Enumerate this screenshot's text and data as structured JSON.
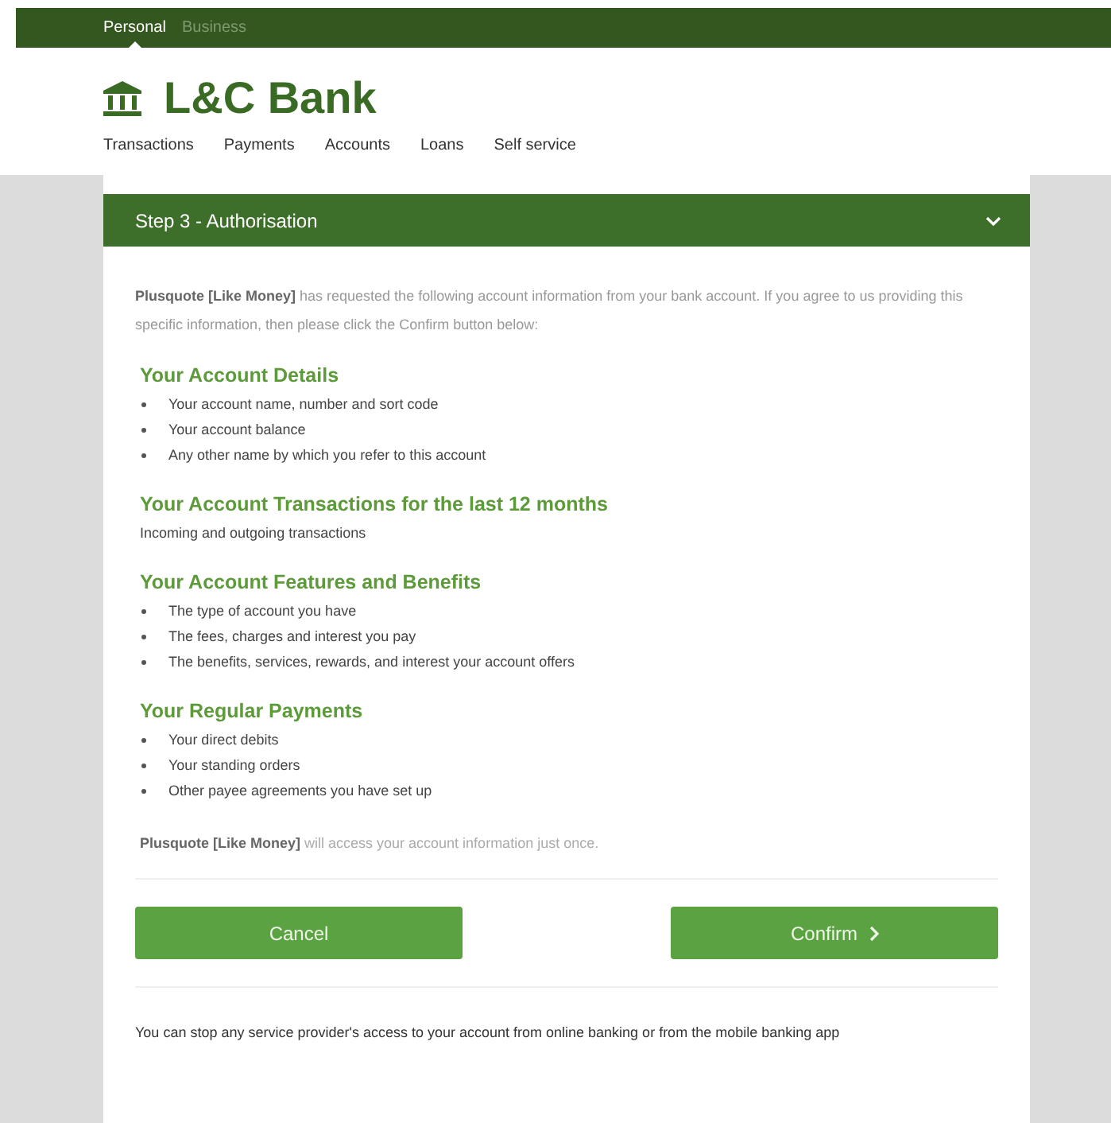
{
  "segments": [
    {
      "label": "Personal",
      "selected": true
    },
    {
      "label": "Business",
      "selected": false
    }
  ],
  "logo": {
    "text": "L&C Bank"
  },
  "nav": [
    "Transactions",
    "Payments",
    "Accounts",
    "Loans",
    "Self service"
  ],
  "step": {
    "title": "Step 3 - Authorisation",
    "expanded": true
  },
  "intro": "**Plusquote [Like Money]** has requested the following account information from your bank account. If you agree to us providing this specific information, then please click the Confirm button below:",
  "sections": [
    {
      "heading": "Your Account Details",
      "kind": "list",
      "items": [
        "Your account name, number and sort code",
        "Your account balance",
        "Any other name by which you refer to this account"
      ]
    },
    {
      "heading": "Your Account Transactions for the last 12 months",
      "kind": "text",
      "items": [
        "Incoming and outgoing transactions"
      ]
    },
    {
      "heading": "Your Account Features and Benefits",
      "kind": "list",
      "items": [
        "The type of account you have",
        "The fees, charges and interest you pay",
        "The benefits, services, rewards, and interest your account offers"
      ]
    },
    {
      "heading": "Your Regular Payments",
      "kind": "list",
      "items": [
        "Your direct debits",
        "Your standing orders",
        "Other payee agreements you have set up"
      ]
    }
  ],
  "access_note": "**Plusquote [Like Money]** will access your account information just once.",
  "buttons": {
    "cancel": "Cancel",
    "confirm": "Confirm"
  },
  "footer_note": "You can stop any service provider's access to your account from online banking or from the mobile banking app"
}
